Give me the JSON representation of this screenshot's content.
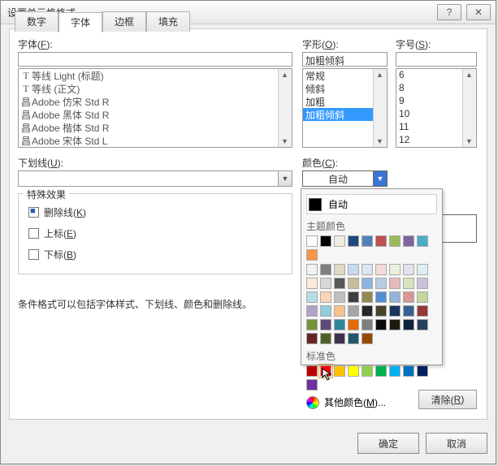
{
  "title": "设置单元格格式",
  "tabs": [
    "数字",
    "字体",
    "边框",
    "填充"
  ],
  "activeTab": 1,
  "labels": {
    "font": "字体(F):",
    "style": "字形(O):",
    "size": "字号(S):",
    "underline": "下划线(U):",
    "color": "颜色(C):",
    "effects": "特殊效果",
    "strike": "删除线(K)",
    "sup": "上标(E)",
    "sub": "下标(B)",
    "clear": "清除(R)",
    "ok": "确定",
    "cancel": "取消"
  },
  "fontInput": "",
  "fontList": [
    {
      "glyph": "T",
      "name": "等线 Light (标题)"
    },
    {
      "glyph": "T",
      "name": "等线 (正文)"
    },
    {
      "glyph": "昌",
      "name": "Adobe 仿宋 Std R"
    },
    {
      "glyph": "昌",
      "name": "Adobe 黑体 Std R"
    },
    {
      "glyph": "昌",
      "name": "Adobe 楷体 Std R"
    },
    {
      "glyph": "昌",
      "name": "Adobe 宋体 Std L"
    }
  ],
  "styleInput": "加粗倾斜",
  "styleList": [
    "常规",
    "倾斜",
    "加粗",
    "加粗倾斜"
  ],
  "styleSelected": 3,
  "sizeInput": "",
  "sizeList": [
    "6",
    "8",
    "9",
    "10",
    "11",
    "12"
  ],
  "underlineValue": "",
  "colorValue": "自动",
  "fx": {
    "strike": true,
    "sup": false,
    "sub": false
  },
  "hint": "条件格式可以包括字体样式、下划线、颜色和删除线。",
  "colorPopup": {
    "auto": "自动",
    "themeTitle": "主题颜色",
    "themeRow": [
      "#ffffff",
      "#000000",
      "#eeece1",
      "#1f497d",
      "#4f81bd",
      "#c0504d",
      "#9bbb59",
      "#8064a2",
      "#4bacc6",
      "#f79646"
    ],
    "themeGrid": [
      [
        "#f2f2f2",
        "#7f7f7f",
        "#ddd9c3",
        "#c6d9f0",
        "#dbe5f1",
        "#f2dcdb",
        "#ebf1dd",
        "#e5e0ec",
        "#dbeef3",
        "#fdeada"
      ],
      [
        "#d8d8d8",
        "#595959",
        "#c4bd97",
        "#8db3e2",
        "#b8cce4",
        "#e5b9b7",
        "#d7e3bc",
        "#ccc1d9",
        "#b7dde8",
        "#fbd5b5"
      ],
      [
        "#bfbfbf",
        "#3f3f3f",
        "#938953",
        "#548dd4",
        "#95b3d7",
        "#d99694",
        "#c3d69b",
        "#b2a1c7",
        "#92cddc",
        "#fac08f"
      ],
      [
        "#a5a5a5",
        "#262626",
        "#494429",
        "#17365d",
        "#366092",
        "#953734",
        "#76923c",
        "#5f497a",
        "#31859b",
        "#e36c09"
      ],
      [
        "#7f7f7f",
        "#0c0c0c",
        "#1d1b10",
        "#0f243e",
        "#244061",
        "#632423",
        "#4f6128",
        "#3f3151",
        "#205867",
        "#974806"
      ]
    ],
    "stdTitle": "标准色",
    "stdRow": [
      "#c00000",
      "#ff0000",
      "#ffc000",
      "#ffff00",
      "#92d050",
      "#00b050",
      "#00b0f0",
      "#0070c0",
      "#002060",
      "#7030a0"
    ],
    "more": "其他颜色(M)..."
  }
}
